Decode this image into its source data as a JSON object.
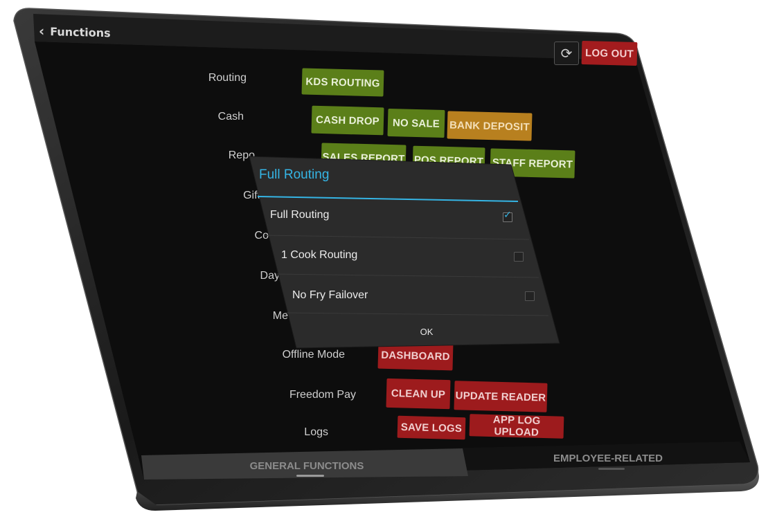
{
  "header": {
    "back_icon": "chevron-left-icon",
    "title": "Functions"
  },
  "toolbar": {
    "refresh_icon": "refresh-icon",
    "logout_label": "LOG OUT"
  },
  "sections": {
    "routing": {
      "label": "Routing",
      "buttons": [
        "KDS ROUTING"
      ]
    },
    "cash": {
      "label": "Cash",
      "buttons": [
        "CASH DROP",
        "NO SALE",
        "BANK DEPOSIT"
      ]
    },
    "reports": {
      "label": "Repo",
      "buttons": [
        "SALES REPORT",
        "POS REPORT",
        "STAFF REPORT"
      ]
    },
    "gift": {
      "label": "Gift"
    },
    "co": {
      "label": "Co"
    },
    "day": {
      "label": "Day"
    },
    "me": {
      "label": "Me"
    },
    "offline": {
      "label": "Offline Mode",
      "buttons": [
        "DASHBOARD"
      ]
    },
    "freedom": {
      "label": "Freedom Pay",
      "buttons": [
        "CLEAN UP",
        "UPDATE READER"
      ]
    },
    "logs": {
      "label": "Logs",
      "buttons": [
        "SAVE LOGS",
        "APP LOG UPLOAD"
      ]
    }
  },
  "tabs": {
    "general": "GENERAL FUNCTIONS",
    "employee": "EMPLOYEE-RELATED"
  },
  "dialog": {
    "title": "Full Routing",
    "options": [
      {
        "label": "Full Routing",
        "checked": true
      },
      {
        "label": "1 Cook Routing",
        "checked": false
      },
      {
        "label": "No Fry Failover",
        "checked": false
      }
    ],
    "ok_label": "OK"
  },
  "colors": {
    "accent": "#35b5e5",
    "green": "#5b7f19",
    "orange": "#b8801f",
    "red": "#9d1b1d"
  }
}
